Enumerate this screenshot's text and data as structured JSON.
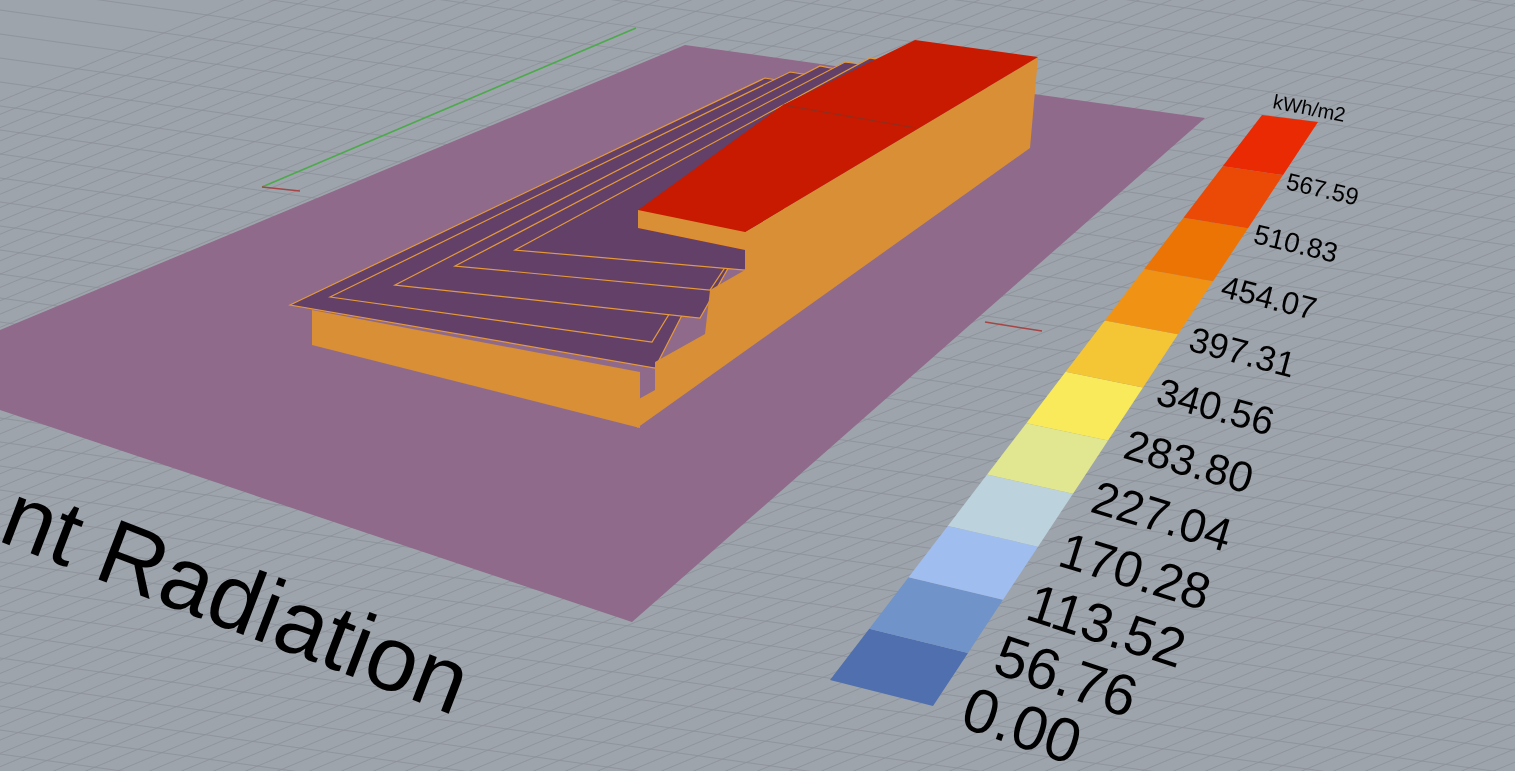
{
  "viewport": {
    "title": "nt Radiation"
  },
  "legend": {
    "unit": "kWh/m2",
    "bins": [
      {
        "label": "0.00",
        "color": "#4f6faf"
      },
      {
        "label": "56.76",
        "color": "#7093c9"
      },
      {
        "label": "113.52",
        "color": "#a0bdf0"
      },
      {
        "label": "170.28",
        "color": "#bcd2dc"
      },
      {
        "label": "227.04",
        "color": "#e1e690"
      },
      {
        "label": "283.80",
        "color": "#f8ea5a"
      },
      {
        "label": "340.56",
        "color": "#f4c535"
      },
      {
        "label": "397.31",
        "color": "#f09315"
      },
      {
        "label": "454.07",
        "color": "#ec7405"
      },
      {
        "label": "510.83",
        "color": "#ea4a05"
      },
      {
        "label": "567.59",
        "color": "#e92a03"
      }
    ]
  }
}
